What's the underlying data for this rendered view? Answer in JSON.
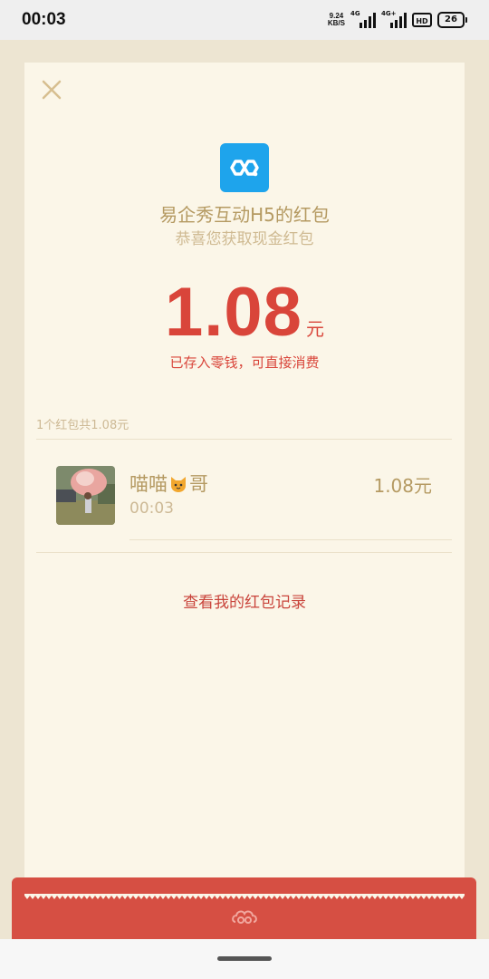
{
  "status_bar": {
    "time": "00:03",
    "net_speed_value": "9.24",
    "net_speed_unit": "KB/S",
    "signal1_tag": "4G",
    "signal2_tag": "4G+",
    "hd_label": "HD",
    "battery_level": "26"
  },
  "packet": {
    "sender_title": "易企秀互动H5的红包",
    "subtitle": "恭喜您获取现金红包",
    "amount": "1.08",
    "amount_unit": "元",
    "note": "已存入零钱，可直接消费",
    "summary": "1个红包共1.08元"
  },
  "recipient": {
    "name_part1": "喵喵",
    "name_emoji": "cat-face-emoji",
    "name_part2": "哥",
    "time": "00:03",
    "amount": "1.08元"
  },
  "links": {
    "history": "查看我的红包记录"
  },
  "colors": {
    "accent_red": "#d9453a",
    "gold_text": "#b59a62",
    "card_bg": "#fbf6e8",
    "page_bg": "#ede5d2",
    "logo_blue": "#1ea4ec"
  },
  "icons": {
    "close": "close-icon",
    "app_logo": "eqxiu-logo-icon",
    "footer_logo": "cloud-swirl-icon"
  }
}
